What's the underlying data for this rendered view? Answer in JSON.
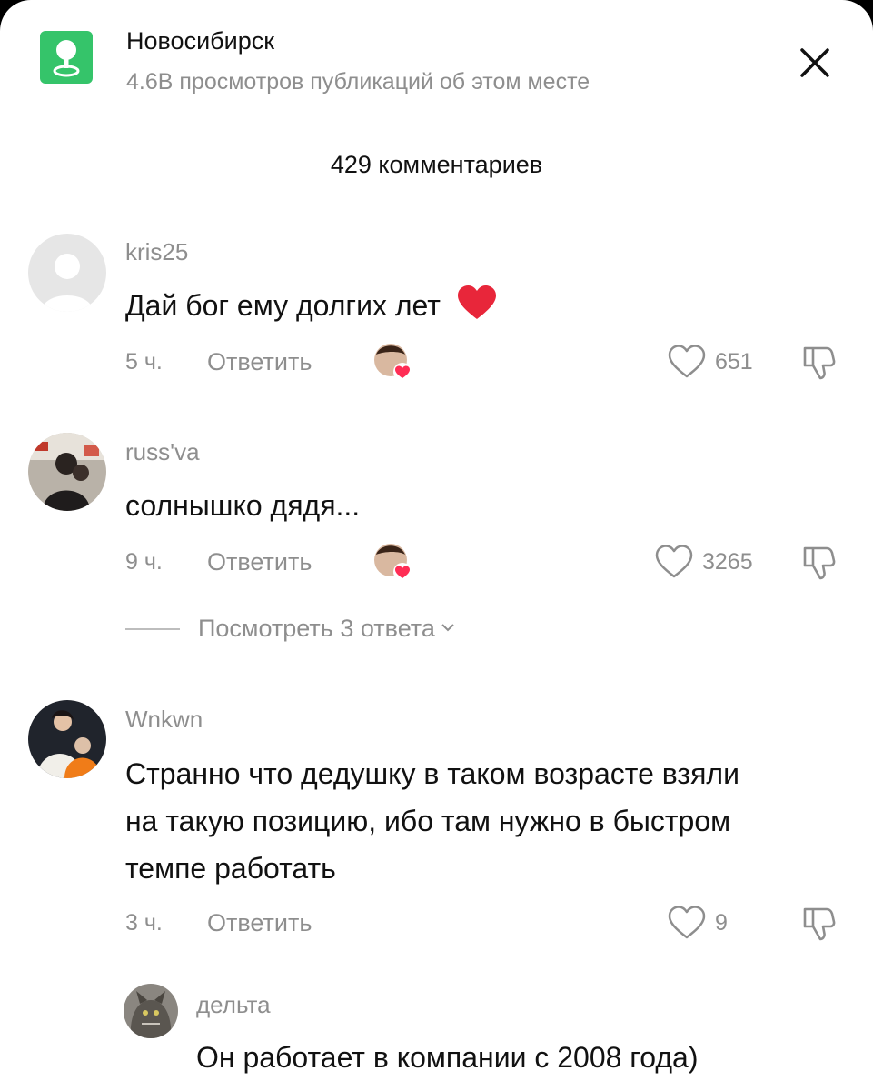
{
  "header": {
    "location_icon": "location-pin-icon",
    "title": "Новосибирск",
    "subtitle": "4.6B просмотров публикаций об этом месте",
    "close_icon": "close-icon"
  },
  "comments_count": "429 комментариев",
  "comments": [
    {
      "username": "kris25",
      "text": "Дай бог ему долгих лет",
      "emoji": "❤️",
      "time": "5 ч.",
      "reply_label": "Ответить",
      "likes": "651"
    },
    {
      "username": "russ'va",
      "text": "солнышко дядя...",
      "time": "9 ч.",
      "reply_label": "Ответить",
      "likes": "3265",
      "view_replies": "Посмотреть 3 ответа"
    },
    {
      "username": "Wnkwn",
      "text_lines": [
        "Странно что дедушку в таком возрасте взяли",
        "на такую позицию, ибо там нужно в быстром",
        "темпе работать"
      ],
      "time": "3 ч.",
      "reply_label": "Ответить",
      "likes": "9"
    }
  ],
  "reply": {
    "username": "дельта",
    "text": "Он работает в компании с 2008 года)"
  },
  "colors": {
    "location_green": "#35c46a",
    "muted_text": "#8e8e8e",
    "heart_red": "#e8263a"
  }
}
